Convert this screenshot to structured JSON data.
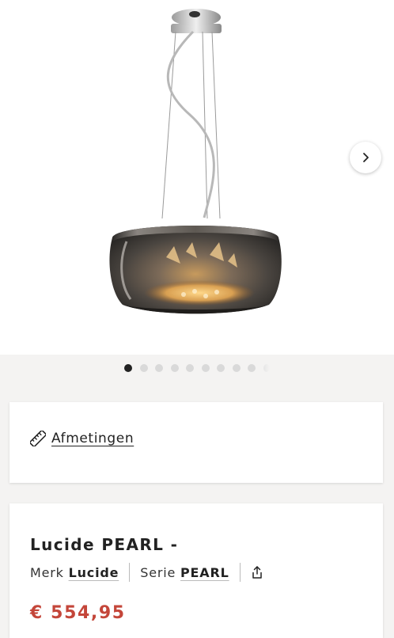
{
  "gallery": {
    "slide_count": 10,
    "active_index": 0,
    "next_icon": "chevron-right-icon"
  },
  "dimensions": {
    "icon": "ruler-icon",
    "label": "Afmetingen"
  },
  "product": {
    "title": "Lucide PEARL -",
    "brand_prefix": "Merk",
    "brand": "Lucide",
    "series_prefix": "Serie",
    "series": "PEARL",
    "share_icon": "share-icon",
    "price": "€ 554,95",
    "price_color": "#c4463a"
  }
}
